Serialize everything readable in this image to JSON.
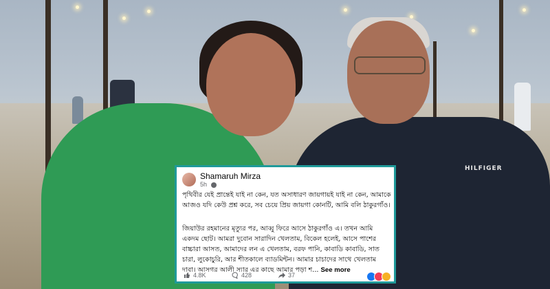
{
  "post": {
    "author": "Shamaruh Mirza",
    "time": "5h",
    "paragraph1": "পৃথিবীর যেই প্রান্তেই যাই না কেন, যত অসাধারণ জায়গায়ই যাই না কেন, আমাকে আজও যদি কেউ প্রশ্ন করে, সব চেয়ে প্রিয় জায়গা কোনটি, আমি বলি ঠাকুরগাঁও।",
    "paragraph2": "জিয়াউর রহমানের মৃত্যুর পর, আব্বু ফিরে আসে ঠাকুরগাঁও এ। তখন আমি একদম ছোট। আমরা দুবোন সারাদিন খেলতাম, বিকেল হলেই, আসে পাশের বাচ্চারা আসত, আমাদের লন এ খেলতাম, বরফ পানি, কাবাডি কাবাডি, সাত চারা, লুকোচুরি, আর শীতকালে ব্যাডমিন্টন। আমার চাচাদের সাথে খেলতাম দাবা। আসগর আলী স্যার এর কাছে আমার পড়া শ...",
    "see_more": "See more",
    "likes": "4.8K",
    "comments": "428",
    "shares": "37"
  },
  "photo": {
    "jacket_logo": "HILFIGER"
  },
  "colors": {
    "card_border": "#1f9a9a",
    "text": "#050505",
    "meta": "#65676b"
  },
  "icons": {
    "like": "thumbs-up-icon",
    "comment": "comment-icon",
    "share": "share-icon",
    "privacy": "globe-icon"
  }
}
